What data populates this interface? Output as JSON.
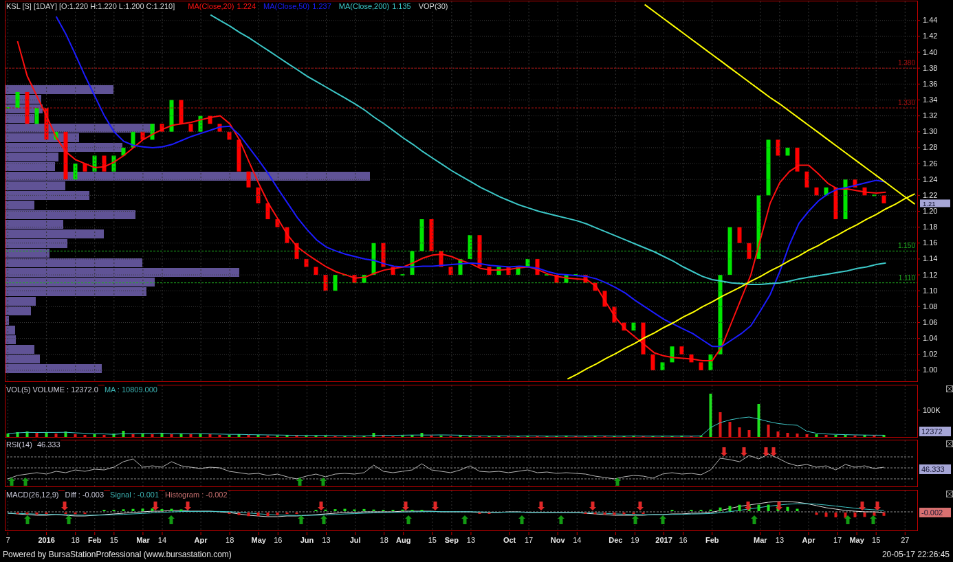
{
  "price_panel": {
    "title": "KSL [S] [1DAY] [O:1.220 H:1.220 L:1.200 C:1.210]",
    "legend_values": [
      "1.224",
      "1.237",
      "1.135"
    ],
    "overlay_label": "VOP(30)",
    "chart_data": {
      "type": "line",
      "ylim": [
        0.987,
        1.464
      ],
      "grid": true,
      "categories": [
        null,
        null,
        null,
        null,
        null,
        null,
        null,
        null,
        null,
        null,
        null,
        null,
        null,
        null,
        null,
        null,
        null,
        null,
        null,
        null,
        null,
        null,
        null,
        null,
        null,
        null,
        null,
        null,
        null,
        null,
        null,
        null,
        null,
        null,
        null,
        null,
        null,
        null,
        null,
        null,
        null,
        null,
        null,
        null,
        null,
        null,
        null,
        null,
        null,
        null,
        null,
        null,
        null,
        null,
        null,
        null,
        null,
        null,
        null,
        null,
        null,
        null,
        null,
        null,
        null,
        null,
        null,
        null,
        null,
        null,
        null,
        null,
        null,
        null,
        null,
        null,
        null,
        null,
        null,
        null,
        null,
        null,
        null,
        null,
        null,
        null,
        null,
        null,
        null,
        null,
        null,
        null,
        null,
        null,
        null
      ],
      "yticks": [
        {
          "value": 1.0,
          "label": "1.00"
        },
        {
          "value": 1.02,
          "label": "1.02"
        },
        {
          "value": 1.04,
          "label": "1.04"
        },
        {
          "value": 1.06,
          "label": "1.06"
        },
        {
          "value": 1.08,
          "label": "1.08"
        },
        {
          "value": 1.1,
          "label": "1.10"
        },
        {
          "value": 1.12,
          "label": "1.12"
        },
        {
          "value": 1.14,
          "label": "1.14"
        },
        {
          "value": 1.16,
          "label": "1.16"
        },
        {
          "value": 1.18,
          "label": "1.18"
        },
        {
          "value": 1.2,
          "label": "1.20"
        },
        {
          "value": 1.22,
          "label": "1.22"
        },
        {
          "value": 1.24,
          "label": "1.24"
        },
        {
          "value": 1.26,
          "label": "1.26"
        },
        {
          "value": 1.28,
          "label": "1.28"
        },
        {
          "value": 1.3,
          "label": "1.30"
        },
        {
          "value": 1.32,
          "label": "1.32"
        },
        {
          "value": 1.34,
          "label": "1.34"
        },
        {
          "value": 1.36,
          "label": "1.36"
        },
        {
          "value": 1.38,
          "label": "1.38"
        },
        {
          "value": 1.4,
          "label": "1.40"
        },
        {
          "value": 1.42,
          "label": "1.42"
        },
        {
          "value": 1.44,
          "label": "1.44"
        }
      ],
      "series": [
        {
          "name": "MA(Close,20)",
          "color": "#ff1010",
          "values": [
            null,
            1.414,
            1.37,
            1.345,
            1.32,
            1.293,
            1.275,
            1.265,
            1.26,
            1.255,
            1.256,
            1.262,
            1.27,
            1.28,
            1.29,
            1.297,
            1.303,
            1.308,
            1.31,
            1.312,
            1.315,
            1.318,
            1.32,
            1.31,
            1.29,
            1.262,
            1.235,
            1.21,
            1.19,
            1.17,
            1.155,
            1.146,
            1.138,
            1.13,
            1.124,
            1.12,
            1.116,
            1.117,
            1.122,
            1.126,
            1.128,
            1.13,
            1.135,
            1.141,
            1.145,
            1.146,
            1.143,
            1.138,
            1.134,
            1.128,
            1.126,
            1.126,
            1.127,
            1.129,
            1.13,
            1.126,
            1.121,
            1.118,
            1.116,
            1.115,
            1.114,
            1.105,
            1.085,
            1.066,
            1.052,
            1.042,
            1.032,
            1.022,
            1.018,
            1.016,
            1.015,
            1.014,
            1.012,
            1.012,
            1.03,
            1.06,
            1.09,
            1.12,
            1.165,
            1.21,
            1.236,
            1.25,
            1.258,
            1.258,
            1.247,
            1.235,
            1.228,
            1.228,
            1.226,
            1.224,
            1.223,
            1.224,
            null,
            null,
            null
          ]
        },
        {
          "name": "MA(Close,50)",
          "color": "#1c1cff",
          "values": [
            null,
            null,
            null,
            null,
            null,
            1.445,
            1.423,
            1.397,
            1.37,
            1.345,
            1.32,
            1.3,
            1.288,
            1.283,
            1.281,
            1.28,
            1.281,
            1.284,
            1.289,
            1.294,
            1.298,
            1.302,
            1.306,
            1.307,
            1.296,
            1.28,
            1.264,
            1.247,
            1.228,
            1.21,
            1.192,
            1.177,
            1.164,
            1.155,
            1.15,
            1.146,
            1.143,
            1.14,
            1.138,
            1.134,
            1.131,
            1.13,
            1.13,
            1.131,
            1.131,
            1.132,
            1.133,
            1.134,
            1.135,
            1.134,
            1.132,
            1.131,
            1.13,
            1.131,
            1.13,
            1.128,
            1.124,
            1.121,
            1.12,
            1.119,
            1.118,
            1.115,
            1.11,
            1.104,
            1.097,
            1.088,
            1.08,
            1.072,
            1.064,
            1.058,
            1.052,
            1.046,
            1.038,
            1.03,
            1.03,
            1.038,
            1.046,
            1.056,
            1.075,
            1.095,
            1.124,
            1.158,
            1.185,
            1.2,
            1.213,
            1.222,
            1.228,
            1.23,
            1.233,
            1.236,
            1.239,
            1.237,
            null,
            null,
            null
          ]
        },
        {
          "name": "MA(Close,200)",
          "color": "#3cc8c8",
          "values": [
            null,
            null,
            null,
            null,
            null,
            null,
            null,
            null,
            null,
            null,
            null,
            null,
            null,
            null,
            null,
            null,
            null,
            null,
            null,
            null,
            null,
            1.447,
            1.44,
            1.433,
            1.425,
            1.418,
            1.41,
            1.402,
            1.394,
            1.386,
            1.378,
            1.37,
            1.363,
            1.356,
            1.349,
            1.342,
            1.335,
            1.327,
            1.318,
            1.31,
            1.301,
            1.292,
            1.284,
            1.275,
            1.267,
            1.259,
            1.251,
            1.244,
            1.237,
            1.23,
            1.224,
            1.218,
            1.213,
            1.208,
            1.204,
            1.2,
            1.197,
            1.194,
            1.191,
            1.188,
            1.184,
            1.179,
            1.174,
            1.169,
            1.164,
            1.159,
            1.154,
            1.149,
            1.143,
            1.137,
            1.13,
            1.124,
            1.118,
            1.114,
            1.112,
            1.11,
            1.109,
            1.108,
            1.108,
            1.109,
            1.11,
            1.112,
            1.115,
            1.117,
            1.119,
            1.121,
            1.123,
            1.125,
            1.128,
            1.13,
            1.133,
            1.135,
            null,
            null,
            null
          ]
        },
        {
          "color": "#ffff00",
          "values": [
            null,
            null,
            null,
            null,
            null,
            null,
            null,
            null,
            null,
            null,
            null,
            null,
            null,
            null,
            null,
            null,
            null,
            null,
            null,
            null,
            null,
            null,
            null,
            null,
            null,
            null,
            null,
            null,
            null,
            null,
            null,
            null,
            null,
            null,
            null,
            null,
            null,
            null,
            null,
            null,
            null,
            null,
            null,
            null,
            null,
            null,
            null,
            null,
            null,
            null,
            null,
            null,
            null,
            null,
            null,
            null,
            null,
            null,
            null,
            null,
            null,
            null,
            null,
            null,
            null,
            null,
            1.46,
            1.451,
            1.442,
            1.433,
            1.424,
            1.415,
            1.406,
            1.397,
            1.388,
            1.379,
            1.37,
            1.361,
            1.352,
            1.343,
            1.335,
            1.326,
            1.317,
            1.308,
            1.299,
            1.29,
            1.281,
            1.272,
            1.263,
            1.254,
            1.245,
            1.236,
            1.227,
            1.218,
            1.209
          ]
        },
        {
          "color": "#ffff00",
          "values": [
            null,
            null,
            null,
            null,
            null,
            null,
            null,
            null,
            null,
            null,
            null,
            null,
            null,
            null,
            null,
            null,
            null,
            null,
            null,
            null,
            null,
            null,
            null,
            null,
            null,
            null,
            null,
            null,
            null,
            null,
            null,
            null,
            null,
            null,
            null,
            null,
            null,
            null,
            null,
            null,
            null,
            null,
            null,
            null,
            null,
            null,
            null,
            null,
            null,
            null,
            null,
            null,
            null,
            null,
            null,
            null,
            null,
            null,
            0.989,
            0.995,
            1.002,
            1.008,
            1.015,
            1.021,
            1.028,
            1.034,
            1.041,
            1.047,
            1.054,
            1.06,
            1.067,
            1.073,
            1.08,
            1.086,
            1.093,
            1.099,
            1.105,
            1.112,
            1.118,
            1.125,
            1.131,
            1.138,
            1.144,
            1.151,
            1.157,
            1.164,
            1.17,
            1.177,
            1.183,
            1.19,
            1.196,
            1.203,
            1.209,
            1.216,
            1.222
          ]
        }
      ],
      "ref_lines": [
        {
          "axis": "y",
          "value": 1.38,
          "label": "1.380",
          "color": "#b01010"
        },
        {
          "axis": "y",
          "value": 1.33,
          "label": "1.330",
          "color": "#b01010"
        },
        {
          "axis": "y",
          "value": 1.15,
          "label": "1.150",
          "color": "#20b020"
        },
        {
          "axis": "y",
          "value": 1.11,
          "label": "1.110",
          "color": "#20b020"
        }
      ]
    },
    "last_price": "1.21"
  },
  "volume_panel": {
    "legend": [
      {
        "text": "VOL(5) VOLUME : 12372.0",
        "color": "#d0d0dc"
      },
      {
        "text": "MA : 10809.000",
        "color": "#3cb4b4"
      }
    ],
    "axis_label": "100K",
    "last_value": "12372"
  },
  "rsi_panel": {
    "legend": [
      {
        "text": "RSI(14)",
        "color": "#c8c8d8"
      },
      {
        "text": "46.333",
        "color": "#c8c8d8"
      }
    ],
    "last_value": "46.333"
  },
  "macd_panel": {
    "legend": [
      {
        "text": "MACD(26,12,9)",
        "color": "#c8c8d8"
      },
      {
        "text": "Diff : -0.003",
        "color": "#c8c8d8"
      },
      {
        "text": "Signal : -0.001",
        "color": "#3cb4b4"
      },
      {
        "text": "Histogram : -0.002",
        "color": "#c87070"
      }
    ],
    "last_value": "-0.002"
  },
  "time_axis": {
    "labels": [
      {
        "text": "7",
        "bold": false
      },
      {
        "text": "2016",
        "bold": true
      },
      {
        "text": "18",
        "bold": false
      },
      {
        "text": "Feb",
        "bold": true
      },
      {
        "text": "15",
        "bold": false
      },
      {
        "text": "Mar",
        "bold": true
      },
      {
        "text": "14",
        "bold": false
      },
      {
        "text": "Apr",
        "bold": true
      },
      {
        "text": "18",
        "bold": false
      },
      {
        "text": "May",
        "bold": true
      },
      {
        "text": "16",
        "bold": false
      },
      {
        "text": "Jun",
        "bold": true
      },
      {
        "text": "13",
        "bold": false
      },
      {
        "text": "Jul",
        "bold": true
      },
      {
        "text": "18",
        "bold": false
      },
      {
        "text": "Aug",
        "bold": true
      },
      {
        "text": "15",
        "bold": false
      },
      {
        "text": "Sep",
        "bold": true
      },
      {
        "text": "13",
        "bold": false
      },
      {
        "text": "Oct",
        "bold": true
      },
      {
        "text": "17",
        "bold": false
      },
      {
        "text": "Nov",
        "bold": true
      },
      {
        "text": "14",
        "bold": false
      },
      {
        "text": "Dec",
        "bold": true
      },
      {
        "text": "19",
        "bold": false
      },
      {
        "text": "2017",
        "bold": true
      },
      {
        "text": "16",
        "bold": false
      },
      {
        "text": "Feb",
        "bold": true
      },
      {
        "text": "Mar",
        "bold": true
      },
      {
        "text": "13",
        "bold": false
      },
      {
        "text": "Apr",
        "bold": true
      },
      {
        "text": "17",
        "bold": false
      },
      {
        "text": "May",
        "bold": true
      },
      {
        "text": "15",
        "bold": false
      },
      {
        "text": "27",
        "bold": false
      }
    ]
  },
  "footer": {
    "credit": "Powered by BursaStationProfessional (www.bursastation.com)",
    "timestamp": "20-05-17 22:26:45"
  }
}
